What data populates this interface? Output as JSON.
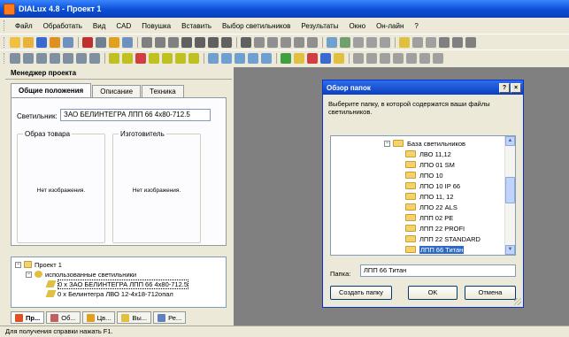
{
  "window": {
    "title": "DIALux 4.8 - Проект 1"
  },
  "menu": [
    "Файл",
    "Обработать",
    "Вид",
    "CAD",
    "Повушка",
    "Вставить",
    "Выбор светильников",
    "Результаты",
    "Окно",
    "Он-лайн",
    "?"
  ],
  "toolbar_colors": {
    "row1": [
      "#f0c040",
      "#e6b43c",
      "#3a6ad0",
      "#e09020",
      "#7090c0",
      "#c03030",
      "#708090",
      "#e0a020",
      "#7090c0",
      "#808080",
      "#808080",
      "#808080",
      "#606060",
      "#606060",
      "#606060",
      "#606060",
      "#606060",
      "#909090",
      "#909090",
      "#909090",
      "#909090",
      "#909090",
      "#70a0d0",
      "#70a070",
      "#a0a0a0",
      "#a0a0a0",
      "#a0a0a0",
      "#e0c040",
      "#a0a0a0",
      "#a0a0a0",
      "#808080",
      "#808080",
      "#808080"
    ],
    "row2": [
      "#8090a0",
      "#8090a0",
      "#8090a0",
      "#8090a0",
      "#8090a0",
      "#8090a0",
      "#8090a0",
      "#c0c020",
      "#c0c020",
      "#d04040",
      "#c0c020",
      "#c0c020",
      "#c0c020",
      "#c0c020",
      "#70a0d0",
      "#70a0d0",
      "#70a0d0",
      "#70a0d0",
      "#70a0d0",
      "#40a040",
      "#e0c040",
      "#d04040",
      "#3a6ad0",
      "#e0c040",
      "#a0a0a0",
      "#a0a0a0",
      "#a0a0a0",
      "#a0a0a0",
      "#a0a0a0",
      "#a0a0a0",
      "#a0a0a0"
    ]
  },
  "panel": {
    "header": "Менеджер проекта",
    "tabs": [
      "Общие положения",
      "Описание",
      "Техника"
    ],
    "luminaire_label": "Светильник:",
    "luminaire_value": "ЗАО БЕЛИНТЕГРА ЛПП 66 4x80-712.5",
    "group_product": {
      "title": "Образ товара",
      "text": "Нет изображения."
    },
    "group_maker": {
      "title": "Изготовитель",
      "text": "Нет изображения."
    },
    "tree": [
      {
        "label": "Проект 1",
        "level": 0,
        "expander": "−"
      },
      {
        "label": "использованные светильники",
        "level": 1,
        "expander": "−"
      },
      {
        "label": "0 x ЗАО БЕЛИНТЕГРА ЛПП 66 4x80-712.5",
        "level": 2,
        "selected": true
      },
      {
        "label": "0 x Белинтегра ЛВО 12-4x18-712опал",
        "level": 2
      }
    ],
    "bottom_tabs": [
      {
        "label": "Пр...",
        "color": "#e05020",
        "active": true
      },
      {
        "label": "Об...",
        "color": "#c06060"
      },
      {
        "label": "Цв...",
        "color": "#e0a020"
      },
      {
        "label": "Вы...",
        "color": "#e0c040"
      },
      {
        "label": "Ре...",
        "color": "#6080c0"
      }
    ]
  },
  "dialog": {
    "title": "Обзор папок",
    "help": "?",
    "close": "×",
    "message": "Выберите папку, в которой содержатся ваши файлы светильников.",
    "folders": [
      {
        "label": "База светильников",
        "level": 0,
        "expander": "−"
      },
      {
        "label": "ЛВО 11,12",
        "level": 1
      },
      {
        "label": "ЛПО 01 SM",
        "level": 1
      },
      {
        "label": "ЛПО 10",
        "level": 1
      },
      {
        "label": "ЛПО 10 IP 66",
        "level": 1
      },
      {
        "label": "ЛПО 11, 12",
        "level": 1
      },
      {
        "label": "ЛПО 22 ALS",
        "level": 1
      },
      {
        "label": "ЛПП 02 PE",
        "level": 1
      },
      {
        "label": "ЛПП 22 PROFI",
        "level": 1
      },
      {
        "label": "ЛПП 22 STANDARD",
        "level": 1
      },
      {
        "label": "ЛПП 66 Титан",
        "level": 1,
        "selected": true
      }
    ],
    "scroll_up": "▲",
    "scroll_down": "▼",
    "folder_label": "Папка:",
    "folder_value": "ЛПП 66 Титан",
    "btn_new": "Создать папку",
    "btn_ok": "OK",
    "btn_cancel": "Отмена"
  },
  "status": "Для получения справки нажать F1."
}
